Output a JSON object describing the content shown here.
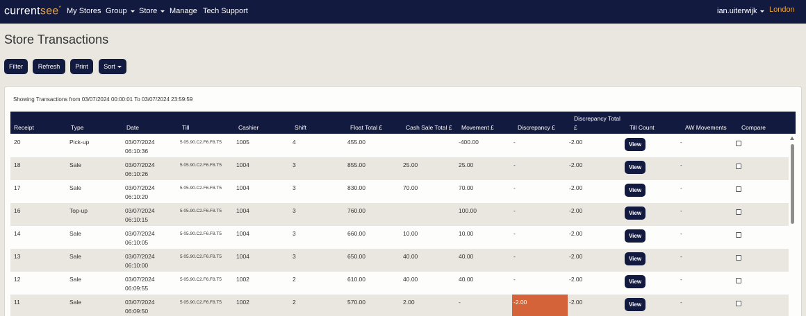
{
  "nav": {
    "logo_a": "current",
    "logo_b": "see",
    "logo_mark": "*",
    "items": [
      {
        "label": "My Stores",
        "dropdown": false
      },
      {
        "label": "Group",
        "dropdown": true
      },
      {
        "label": "Store",
        "dropdown": true
      },
      {
        "label": "Manage",
        "dropdown": false
      },
      {
        "label": "Tech Support",
        "dropdown": false
      }
    ],
    "user": "ian.uiterwijk",
    "location": "London"
  },
  "page_title": "Store Transactions",
  "toolbar": {
    "filter": "Filter",
    "refresh": "Refresh",
    "print": "Print",
    "sort": "Sort"
  },
  "showing_text": "Showing Transactions from 03/07/2024 00:00:01 To 03/07/2024 23:59:59",
  "columns": {
    "receipt": "Receipt",
    "type": "Type",
    "date": "Date",
    "till": "Till",
    "cashier": "Cashier",
    "shift": "Shift",
    "float_total": "Float Total £",
    "cash_sale_total": "Cash Sale Total £",
    "movement": "Movement £",
    "discrepancy": "Discrepancy £",
    "discrepancy_total_1": "Discrepancy Total",
    "discrepancy_total_2": "£",
    "till_count": "Till Count",
    "aw_movements": "AW Movements",
    "compare": "Compare"
  },
  "view_label": "View",
  "rows": [
    {
      "receipt": "20",
      "type": "Pick-up",
      "date": "03/07/2024",
      "time": "06:10:36",
      "till": "5 05.90.C2.F6.F8.T5",
      "cashier": "1005",
      "shift": "4",
      "float": "455.00",
      "cash_sale": "",
      "movement": "-400.00",
      "discrepancy": "-",
      "disc_total": "-2.00",
      "aw": "-",
      "highlight": false
    },
    {
      "receipt": "18",
      "type": "Sale",
      "date": "03/07/2024",
      "time": "06:10:26",
      "till": "5 05.90.C2.F6.F8.T5",
      "cashier": "1004",
      "shift": "3",
      "float": "855.00",
      "cash_sale": "25.00",
      "movement": "25.00",
      "discrepancy": "-",
      "disc_total": "-2.00",
      "aw": "-",
      "highlight": false
    },
    {
      "receipt": "17",
      "type": "Sale",
      "date": "03/07/2024",
      "time": "06:10:20",
      "till": "5 05.90.C2.F6.F8.T5",
      "cashier": "1004",
      "shift": "3",
      "float": "830.00",
      "cash_sale": "70.00",
      "movement": "70.00",
      "discrepancy": "-",
      "disc_total": "-2.00",
      "aw": "-",
      "highlight": false
    },
    {
      "receipt": "16",
      "type": "Top-up",
      "date": "03/07/2024",
      "time": "06:10:15",
      "till": "5 05.90.C2.F6.F8.T5",
      "cashier": "1004",
      "shift": "3",
      "float": "760.00",
      "cash_sale": "",
      "movement": "100.00",
      "discrepancy": "-",
      "disc_total": "-2.00",
      "aw": "-",
      "highlight": false
    },
    {
      "receipt": "14",
      "type": "Sale",
      "date": "03/07/2024",
      "time": "06:10:05",
      "till": "5 05.90.C2.F6.F8.T5",
      "cashier": "1004",
      "shift": "3",
      "float": "660.00",
      "cash_sale": "10.00",
      "movement": "10.00",
      "discrepancy": "-",
      "disc_total": "-2.00",
      "aw": "-",
      "highlight": false
    },
    {
      "receipt": "13",
      "type": "Sale",
      "date": "03/07/2024",
      "time": "06:10:00",
      "till": "5 05.90.C2.F6.F8.T5",
      "cashier": "1004",
      "shift": "3",
      "float": "650.00",
      "cash_sale": "40.00",
      "movement": "40.00",
      "discrepancy": "-",
      "disc_total": "-2.00",
      "aw": "-",
      "highlight": false
    },
    {
      "receipt": "12",
      "type": "Sale",
      "date": "03/07/2024",
      "time": "06:09:55",
      "till": "5 05.90.C2.F6.F8.T5",
      "cashier": "1002",
      "shift": "2",
      "float": "610.00",
      "cash_sale": "40.00",
      "movement": "40.00",
      "discrepancy": "-",
      "disc_total": "-2.00",
      "aw": "-",
      "highlight": false
    },
    {
      "receipt": "11",
      "type": "Sale",
      "date": "03/07/2024",
      "time": "06:09:50",
      "till": "5 05.90.C2.F6.F8.T5",
      "cashier": "1002",
      "shift": "2",
      "float": "570.00",
      "cash_sale": "2.00",
      "movement": "-",
      "discrepancy": "-2.00",
      "disc_total": "-2.00",
      "aw": "-",
      "highlight": true
    }
  ],
  "colors": {
    "navy": "#131a40",
    "accent": "#e8a33d",
    "background": "#e9e7df",
    "discrepancy_highlight": "#d4633a"
  }
}
